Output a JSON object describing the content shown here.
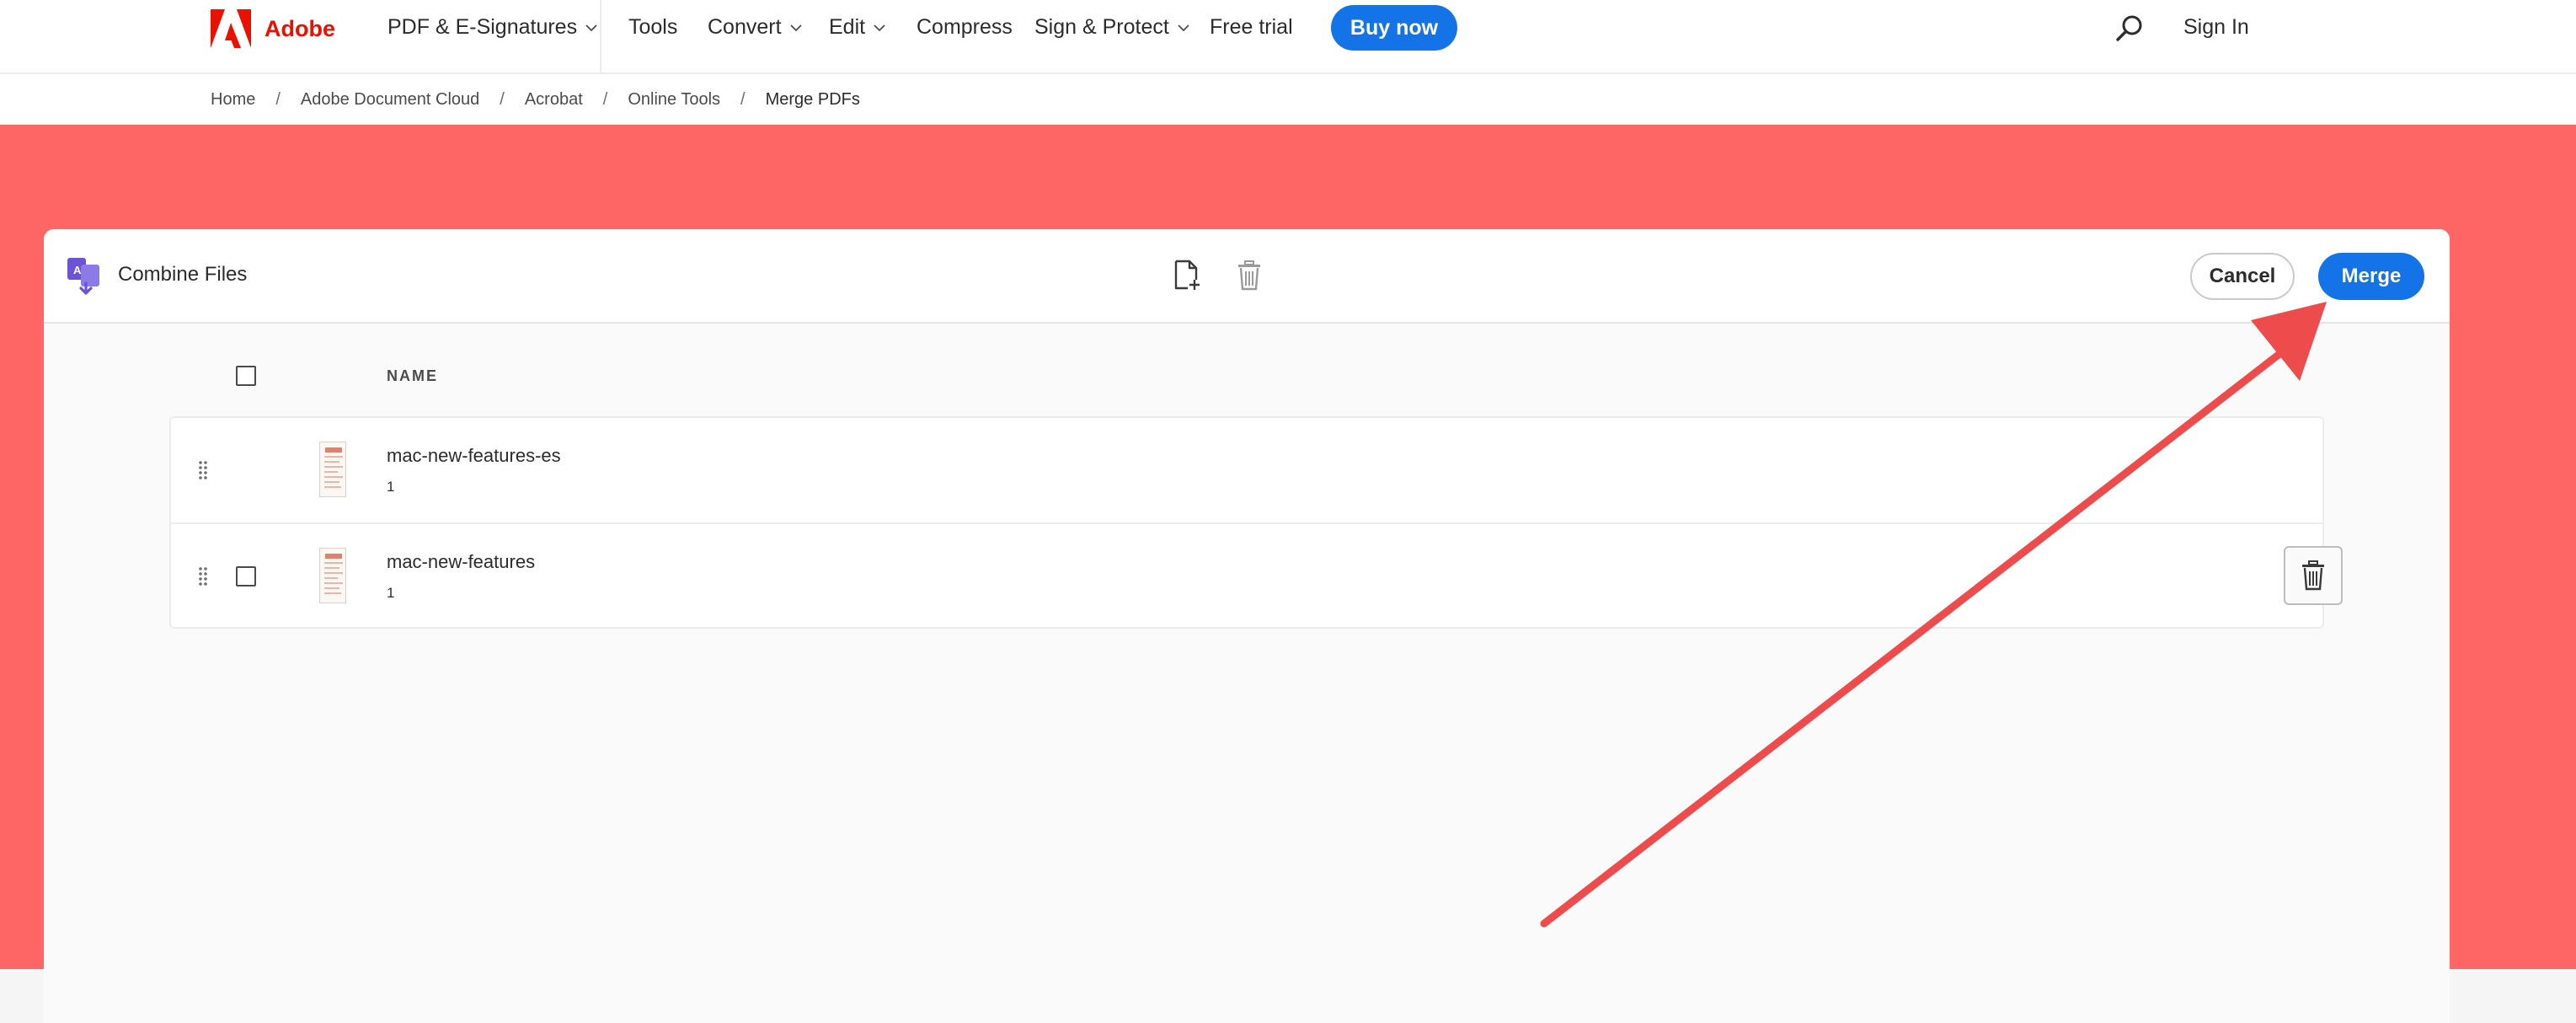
{
  "nav": {
    "brand": "Adobe",
    "items": [
      {
        "label": "PDF & E-Signatures",
        "dropdown": true
      },
      {
        "label": "Tools",
        "dropdown": false
      },
      {
        "label": "Convert",
        "dropdown": true
      },
      {
        "label": "Edit",
        "dropdown": true
      },
      {
        "label": "Compress",
        "dropdown": false
      },
      {
        "label": "Sign & Protect",
        "dropdown": true
      },
      {
        "label": "Free trial",
        "dropdown": false
      }
    ],
    "buy_label": "Buy now",
    "signin_label": "Sign In"
  },
  "breadcrumb": [
    "Home",
    "Adobe Document Cloud",
    "Acrobat",
    "Online Tools",
    "Merge PDFs"
  ],
  "panel": {
    "title": "Combine Files",
    "cancel_label": "Cancel",
    "merge_label": "Merge",
    "column_name": "NAME",
    "files": [
      {
        "name": "mac-new-features-es",
        "pages": "1"
      },
      {
        "name": "mac-new-features",
        "pages": "1"
      }
    ]
  },
  "icons": {
    "logo": "adobe-logo-icon",
    "search": "search-icon",
    "combine": "combine-files-icon",
    "add_file": "add-file-icon",
    "trash": "trash-icon",
    "drag": "drag-handle-icon",
    "chevron": "chevron-down-icon"
  },
  "colors": {
    "brand_red": "#eb1000",
    "accent_blue": "#1473e6",
    "hero_bg": "#fe6666",
    "annotation_arrow": "#ee4c4c",
    "combine_icon": "#6b52d6"
  }
}
